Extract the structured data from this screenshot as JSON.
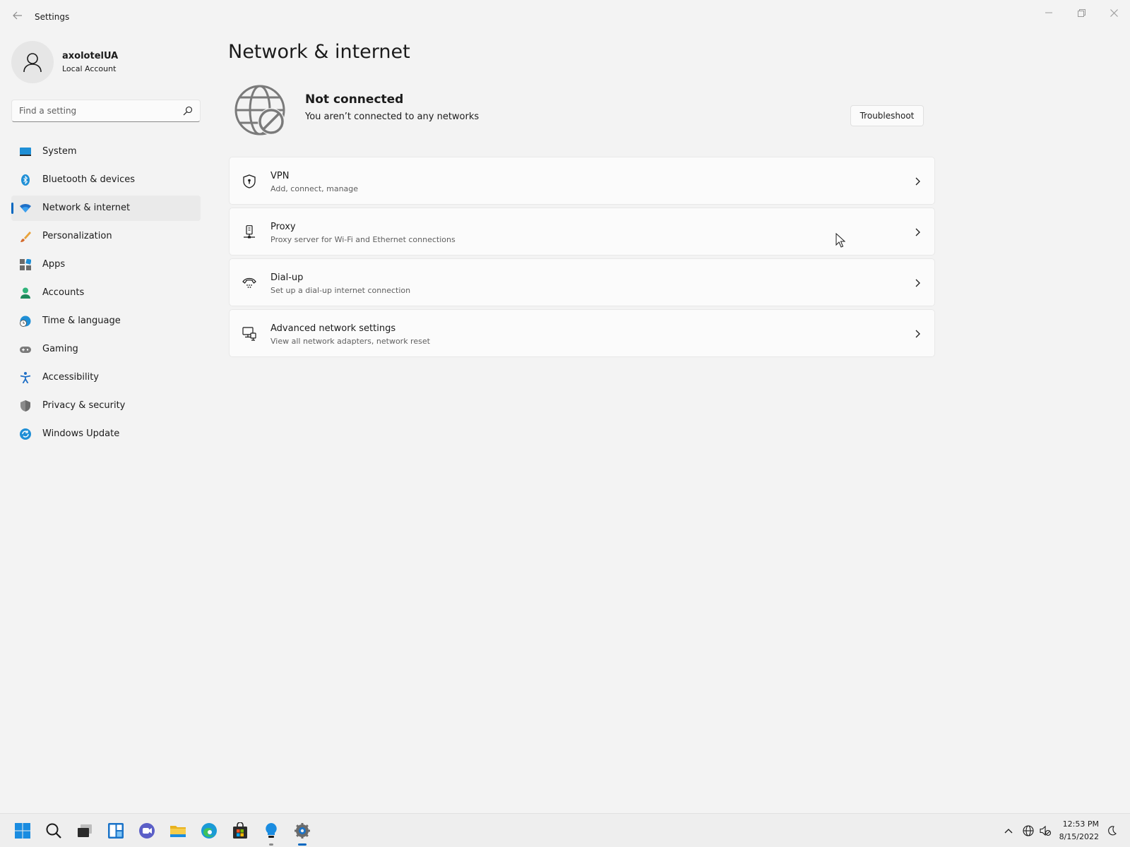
{
  "window": {
    "app_title": "Settings",
    "controls": [
      "minimize-icon",
      "maximize-icon",
      "close-icon"
    ]
  },
  "profile": {
    "name": "axolotelUA",
    "account_type": "Local Account"
  },
  "search": {
    "placeholder": "Find a setting",
    "icon": "search-icon"
  },
  "sidebar": {
    "items": [
      {
        "label": "System",
        "icon": "system-icon"
      },
      {
        "label": "Bluetooth & devices",
        "icon": "bluetooth-icon"
      },
      {
        "label": "Network & internet",
        "icon": "wifi-icon",
        "active": true
      },
      {
        "label": "Personalization",
        "icon": "brush-icon"
      },
      {
        "label": "Apps",
        "icon": "apps-icon"
      },
      {
        "label": "Accounts",
        "icon": "accounts-icon"
      },
      {
        "label": "Time & language",
        "icon": "globe-clock-icon"
      },
      {
        "label": "Gaming",
        "icon": "gamepad-icon"
      },
      {
        "label": "Accessibility",
        "icon": "accessibility-icon"
      },
      {
        "label": "Privacy & security",
        "icon": "shield-icon"
      },
      {
        "label": "Windows Update",
        "icon": "update-icon"
      }
    ],
    "accent": "#0067c0"
  },
  "main": {
    "title": "Network & internet",
    "status": {
      "title": "Not connected",
      "description": "You aren’t connected to any networks",
      "icon": "globe-blocked-icon"
    },
    "troubleshoot_label": "Troubleshoot",
    "cards": [
      {
        "title": "VPN",
        "subtitle": "Add, connect, manage",
        "icon": "vpn-shield-icon"
      },
      {
        "title": "Proxy",
        "subtitle": "Proxy server for Wi-Fi and Ethernet connections",
        "icon": "proxy-icon"
      },
      {
        "title": "Dial-up",
        "subtitle": "Set up a dial-up internet connection",
        "icon": "dialup-icon"
      },
      {
        "title": "Advanced network settings",
        "subtitle": "View all network adapters, network reset",
        "icon": "advanced-network-icon"
      }
    ]
  },
  "taskbar": {
    "apps": [
      "start-icon",
      "search-icon",
      "task-view-icon",
      "widgets-icon",
      "chat-icon",
      "file-explorer-icon",
      "edge-icon",
      "store-icon",
      "tips-icon",
      "settings-icon"
    ],
    "tray": [
      "chevron-up-icon",
      "network-globe-icon",
      "sound-muted-icon"
    ],
    "time": "12:53 PM",
    "date": "8/15/2022"
  }
}
